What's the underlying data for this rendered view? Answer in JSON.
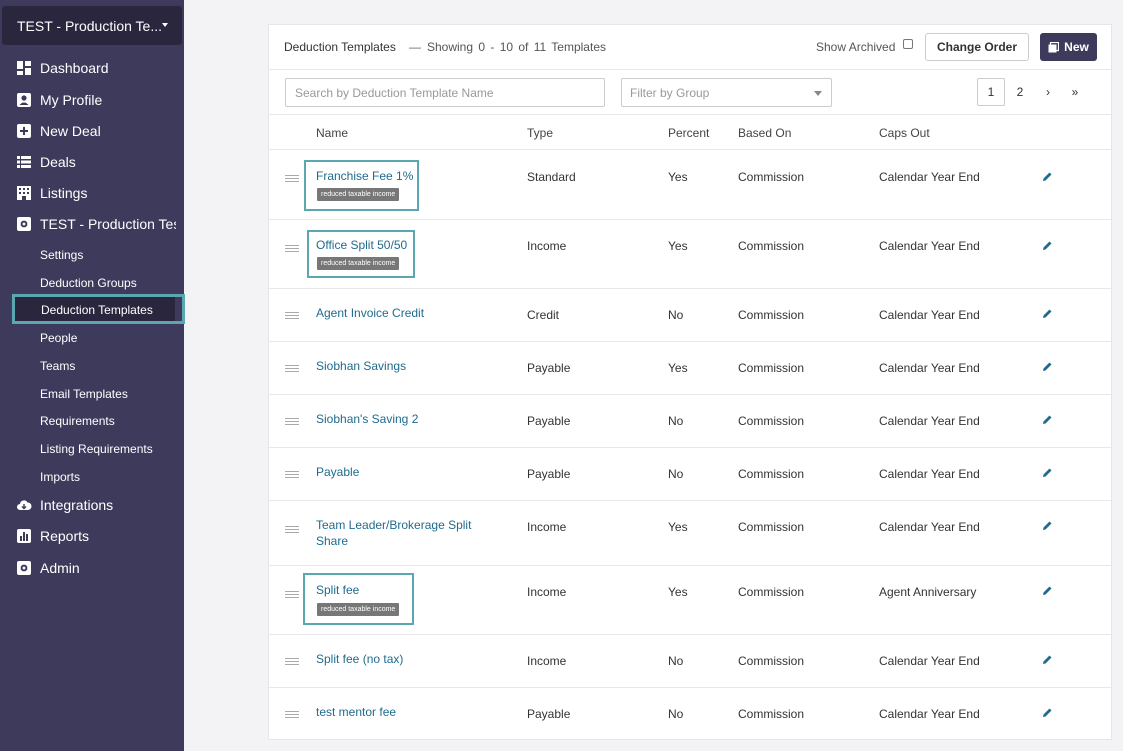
{
  "sidebar": {
    "org_name": "TEST - Production Te...",
    "nav": [
      {
        "label": "Dashboard",
        "icon": "dashboard-icon"
      },
      {
        "label": "My Profile",
        "icon": "user-icon"
      },
      {
        "label": "New Deal",
        "icon": "plus-square-icon"
      },
      {
        "label": "Deals",
        "icon": "list-icon"
      },
      {
        "label": "Listings",
        "icon": "building-icon"
      },
      {
        "label": "TEST - Production Test",
        "icon": "gear-icon"
      }
    ],
    "sub": [
      "Settings",
      "Deduction Groups",
      "Deduction Templates",
      "People",
      "Teams",
      "Email Templates",
      "Requirements",
      "Listing Requirements",
      "Imports"
    ],
    "bottom": [
      {
        "label": "Integrations",
        "icon": "cloud-icon"
      },
      {
        "label": "Reports",
        "icon": "chart-icon"
      },
      {
        "label": "Admin",
        "icon": "gear-icon"
      }
    ]
  },
  "header": {
    "title": "Deduction Templates",
    "separator": "—",
    "showing": "Showing 0 - 10 of 11 Templates",
    "show_archived": "Show Archived",
    "change_order": "Change Order",
    "new": "New"
  },
  "search": {
    "placeholder": "Search by Deduction Template Name"
  },
  "filter": {
    "placeholder": "Filter by Group"
  },
  "pagination": {
    "p1": "1",
    "p2": "2",
    "next": "›",
    "last": "»"
  },
  "columns": {
    "name": "Name",
    "type": "Type",
    "percent": "Percent",
    "based_on": "Based On",
    "caps_out": "Caps Out"
  },
  "rows": [
    {
      "name": "Franchise Fee 1%",
      "tag": "reduced taxable income",
      "type": "Standard",
      "percent": "Yes",
      "based_on": "Commission",
      "caps_out": "Calendar Year End"
    },
    {
      "name": "Office Split 50/50",
      "tag": "reduced taxable income",
      "type": "Income",
      "percent": "Yes",
      "based_on": "Commission",
      "caps_out": "Calendar Year End"
    },
    {
      "name": "Agent Invoice Credit",
      "type": "Credit",
      "percent": "No",
      "based_on": "Commission",
      "caps_out": "Calendar Year End"
    },
    {
      "name": "Siobhan Savings",
      "type": "Payable",
      "percent": "Yes",
      "based_on": "Commission",
      "caps_out": "Calendar Year End"
    },
    {
      "name": "Siobhan's Saving 2",
      "type": "Payable",
      "percent": "No",
      "based_on": "Commission",
      "caps_out": "Calendar Year End"
    },
    {
      "name": "Payable",
      "type": "Payable",
      "percent": "No",
      "based_on": "Commission",
      "caps_out": "Calendar Year End"
    },
    {
      "name_line1": "Team Leader/Brokerage Split",
      "name_line2": "Share",
      "type": "Income",
      "percent": "Yes",
      "based_on": "Commission",
      "caps_out": "Calendar Year End"
    },
    {
      "name": "Split fee",
      "tag": "reduced taxable income",
      "type": "Income",
      "percent": "Yes",
      "based_on": "Commission",
      "caps_out": "Agent Anniversary"
    },
    {
      "name": "Split fee (no tax)",
      "type": "Income",
      "percent": "No",
      "based_on": "Commission",
      "caps_out": "Calendar Year End"
    },
    {
      "name": "test mentor fee",
      "type": "Payable",
      "percent": "No",
      "based_on": "Commission",
      "caps_out": "Calendar Year End"
    }
  ]
}
